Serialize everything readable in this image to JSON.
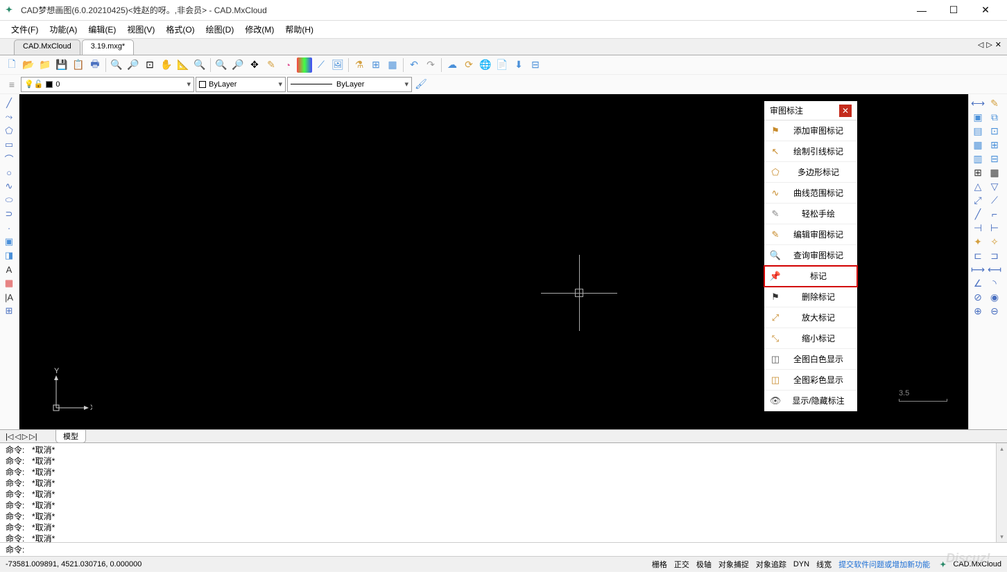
{
  "title": "CAD梦想画图(6.0.20210425)<姓赵的呀。,非会员> - CAD.MxCloud",
  "menus": [
    "文件(F)",
    "功能(A)",
    "编辑(E)",
    "视图(V)",
    "格式(O)",
    "绘图(D)",
    "修改(M)",
    "帮助(H)"
  ],
  "tabs": [
    "CAD.MxCloud",
    "3.19.mxg*"
  ],
  "layer": {
    "current": "0",
    "color": "ByLayer",
    "linetype": "ByLayer"
  },
  "markup": {
    "title": "审图标注",
    "items": [
      {
        "icon": "⚑",
        "color": "#c78a2a",
        "label": "添加审图标记"
      },
      {
        "icon": "↖",
        "color": "#c78a2a",
        "label": "绘制引线标记"
      },
      {
        "icon": "⬠",
        "color": "#c78a2a",
        "label": "多边形标记"
      },
      {
        "icon": "∿",
        "color": "#c78a2a",
        "label": "曲线范围标记"
      },
      {
        "icon": "✎",
        "color": "#888",
        "label": "轻松手绘"
      },
      {
        "icon": "✎",
        "color": "#c78a2a",
        "label": "编辑审图标记"
      },
      {
        "icon": "🔍",
        "color": "#c78a2a",
        "label": "查询审图标记"
      },
      {
        "icon": "📌",
        "color": "#c78a2a",
        "label": "标记",
        "highlighted": true
      },
      {
        "icon": "⚑",
        "color": "#333",
        "label": "删除标记"
      },
      {
        "icon": "⤢",
        "color": "#c78a2a",
        "label": "放大标记"
      },
      {
        "icon": "⤡",
        "color": "#c78a2a",
        "label": "缩小标记"
      },
      {
        "icon": "◫",
        "color": "#555",
        "label": "全图白色显示"
      },
      {
        "icon": "◫",
        "color": "#c78a2a",
        "label": "全图彩色显示"
      },
      {
        "icon": "👁",
        "color": "#555",
        "label": "显示/隐藏标注"
      }
    ]
  },
  "model_tab": "模型",
  "scale_indicator": "3.5",
  "cmd_history": [
    {
      "label": "命令:",
      "text": "*取消*"
    },
    {
      "label": "命令:",
      "text": "*取消*"
    },
    {
      "label": "命令:",
      "text": "*取消*"
    },
    {
      "label": "命令:",
      "text": "*取消*"
    },
    {
      "label": "命令:",
      "text": "*取消*"
    },
    {
      "label": "命令:",
      "text": "*取消*"
    },
    {
      "label": "命令:",
      "text": "*取消*"
    },
    {
      "label": "命令:",
      "text": "*取消*"
    },
    {
      "label": "命令:",
      "text": "*取消*"
    }
  ],
  "cmd_prompt": "命令:",
  "status": {
    "coords": "-73581.009891,  4521.030716,  0.000000",
    "toggles": [
      "栅格",
      "正交",
      "极轴",
      "对象捕捉",
      "对象追踪",
      "DYN",
      "线宽"
    ],
    "link": "提交软件问题或增加新功能",
    "brand": "CAD.MxCloud"
  },
  "watermark": "Discuz!",
  "icons": {
    "new": "🗋",
    "open": "📂",
    "save": "💾",
    "print": "🖨",
    "zoom": "🔍",
    "pan": "✋",
    "undo": "↶",
    "redo": "↷"
  }
}
